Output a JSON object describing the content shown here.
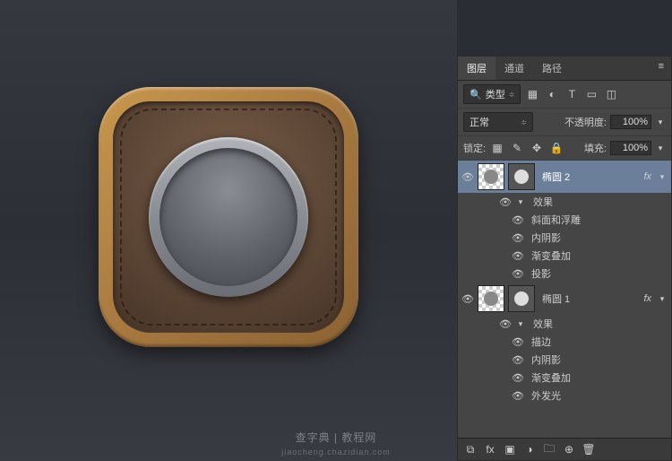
{
  "tabs": {
    "layers": "图层",
    "channels": "通道",
    "paths": "路径"
  },
  "filter": {
    "mode": "类型",
    "search_glyph": "🔍"
  },
  "blend": {
    "mode": "正常",
    "opacity_label": "不透明度:",
    "opacity_value": "100%"
  },
  "lock": {
    "label": "锁定:",
    "fill_label": "填充:",
    "fill_value": "100%"
  },
  "layers": [
    {
      "name": "椭圆 2",
      "fx": "fx",
      "effects_label": "效果",
      "effects": [
        "斜面和浮雕",
        "内阴影",
        "渐变叠加",
        "投影"
      ],
      "selected": true
    },
    {
      "name": "椭圆 1",
      "fx": "fx",
      "effects_label": "效果",
      "effects": [
        "描边",
        "内阴影",
        "渐变叠加",
        "外发光"
      ],
      "selected": false
    }
  ],
  "icons": {
    "visibility": "👁",
    "disclosure_down": "▾",
    "disclosure_right": "▸",
    "menu": "≡",
    "image_filter": "▦",
    "adjust_filter": "◐",
    "type_filter": "T",
    "shape_filter": "▭",
    "smart_filter": "◫",
    "lock_pixels": "▦",
    "lock_brush": "✎",
    "lock_move": "✥",
    "lock_all": "🔒",
    "link": "⧉",
    "fxbtn": "fx",
    "mask": "▣",
    "adjustment": "◑",
    "group": "🗀",
    "new": "⊕",
    "trash": "🗑"
  },
  "watermark": {
    "main": "查字典 | 教程网",
    "sub": "jiaocheng.chazidian.com"
  }
}
